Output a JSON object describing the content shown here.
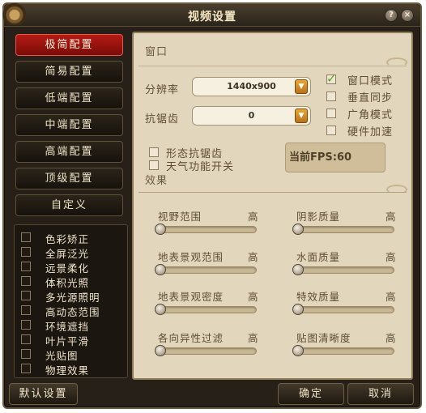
{
  "window": {
    "title": "视频设置",
    "help_label": "?",
    "close_label": "×"
  },
  "presets": [
    {
      "label": "极简配置",
      "active": true
    },
    {
      "label": "简易配置",
      "active": false
    },
    {
      "label": "低端配置",
      "active": false
    },
    {
      "label": "中端配置",
      "active": false
    },
    {
      "label": "高端配置",
      "active": false
    },
    {
      "label": "顶级配置",
      "active": false
    },
    {
      "label": "自定义",
      "active": false
    }
  ],
  "effects": [
    {
      "label": "色彩矫正",
      "checked": false
    },
    {
      "label": "全屏泛光",
      "checked": false
    },
    {
      "label": "远景柔化",
      "checked": false
    },
    {
      "label": "体积光照",
      "checked": false
    },
    {
      "label": "多光源照明",
      "checked": false
    },
    {
      "label": "高动态范围",
      "checked": false
    },
    {
      "label": "环境遮挡",
      "checked": false
    },
    {
      "label": "叶片平滑",
      "checked": false
    },
    {
      "label": "光贴图",
      "checked": false
    },
    {
      "label": "物理效果",
      "checked": false
    }
  ],
  "window_section": {
    "title": "窗口",
    "resolution_label": "分辨率",
    "resolution_value": "1440x900",
    "antialias_label": "抗锯齿",
    "antialias_value": "0",
    "window_mode_label": "窗口模式",
    "window_mode_checked": true,
    "vsync_label": "垂直同步",
    "vsync_checked": false,
    "widescreen_label": "广角模式",
    "widescreen_checked": false,
    "hw_accel_label": "硬件加速",
    "hw_accel_checked": false
  },
  "effects_section": {
    "morph_aa_label": "形态抗锯齿",
    "morph_aa_checked": false,
    "weather_label": "天气功能开关",
    "weather_checked": false,
    "fps_text": "当前FPS:60",
    "title": "效果"
  },
  "sliders": [
    {
      "label": "视野范围",
      "high_label": "高",
      "value": 0
    },
    {
      "label": "阴影质量",
      "high_label": "高",
      "value": 0
    },
    {
      "label": "地表景观范围",
      "high_label": "高",
      "value": 0
    },
    {
      "label": "水面质量",
      "high_label": "高",
      "value": 0
    },
    {
      "label": "地表景观密度",
      "high_label": "高",
      "value": 0
    },
    {
      "label": "特效质量",
      "high_label": "高",
      "value": 0
    },
    {
      "label": "各向异性过滤",
      "high_label": "高",
      "value": 0
    },
    {
      "label": "贴图清晰度",
      "high_label": "高",
      "value": 0
    }
  ],
  "buttons": {
    "default": "默认设置",
    "ok": "确定",
    "cancel": "取消"
  },
  "icons": {
    "logo": "emblem-icon",
    "help": "help-icon",
    "close": "close-icon",
    "dropdown": "double-chevron-down-icon",
    "check": "checkmark-icon"
  },
  "colors": {
    "active_preset": "#b51b14",
    "panel_bg": "#e2d7bd",
    "window_bg": "#262018",
    "checkmark": "#58a31e",
    "dropdown_arrow": "#e8a932"
  }
}
